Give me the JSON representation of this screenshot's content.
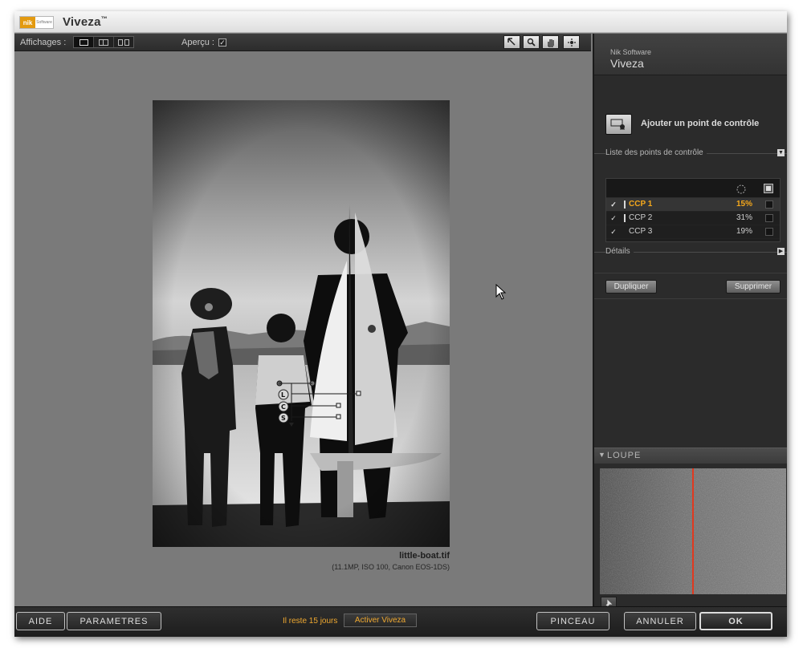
{
  "window": {
    "title": "Viveza",
    "title_mark": "™",
    "logo_primary": "nik",
    "logo_secondary": "Software"
  },
  "toolbar": {
    "display_label": "Affichages :",
    "view_modes": [
      "single-view-icon",
      "split-view-icon",
      "side-by-side-view-icon"
    ],
    "selected_view": "single-view-icon",
    "preview_label": "Aperçu :",
    "preview_checked": true,
    "tools": [
      "select-arrow-icon",
      "zoom-icon",
      "hand-icon",
      "add-point-icon"
    ]
  },
  "preview": {
    "file_name": "little-boat.tif",
    "file_info": "(11.1MP, ISO 100, Canon EOS-1DS)",
    "control_point_sliders": [
      "L",
      "C",
      "S"
    ]
  },
  "panel": {
    "brand": "Nik Software",
    "name": "Viveza",
    "add_point_label": "Ajouter un point de contrôle",
    "list_title": "Liste des points de contrôle",
    "details_title": "Détails",
    "duplicate_label": "Dupliquer",
    "delete_label": "Supprimer",
    "control_points": [
      {
        "name": "CCP 1",
        "percent": "15%",
        "checked": true,
        "active": true
      },
      {
        "name": "CCP 2",
        "percent": "31%",
        "checked": true,
        "active": false
      },
      {
        "name": "CCP 3",
        "percent": "19%",
        "checked": true,
        "active": false
      }
    ],
    "loupe_title": "LOUPE"
  },
  "bottom": {
    "help_label": "AIDE",
    "settings_label": "PARAMETRES",
    "trial_text": "Il reste 15 jours",
    "activate_label": "Activer Viveza",
    "brush_label": "PINCEAU",
    "cancel_label": "ANNULER",
    "ok_label": "OK"
  },
  "colors": {
    "accent": "#f0a930",
    "loupe_line": "#e0391f"
  }
}
